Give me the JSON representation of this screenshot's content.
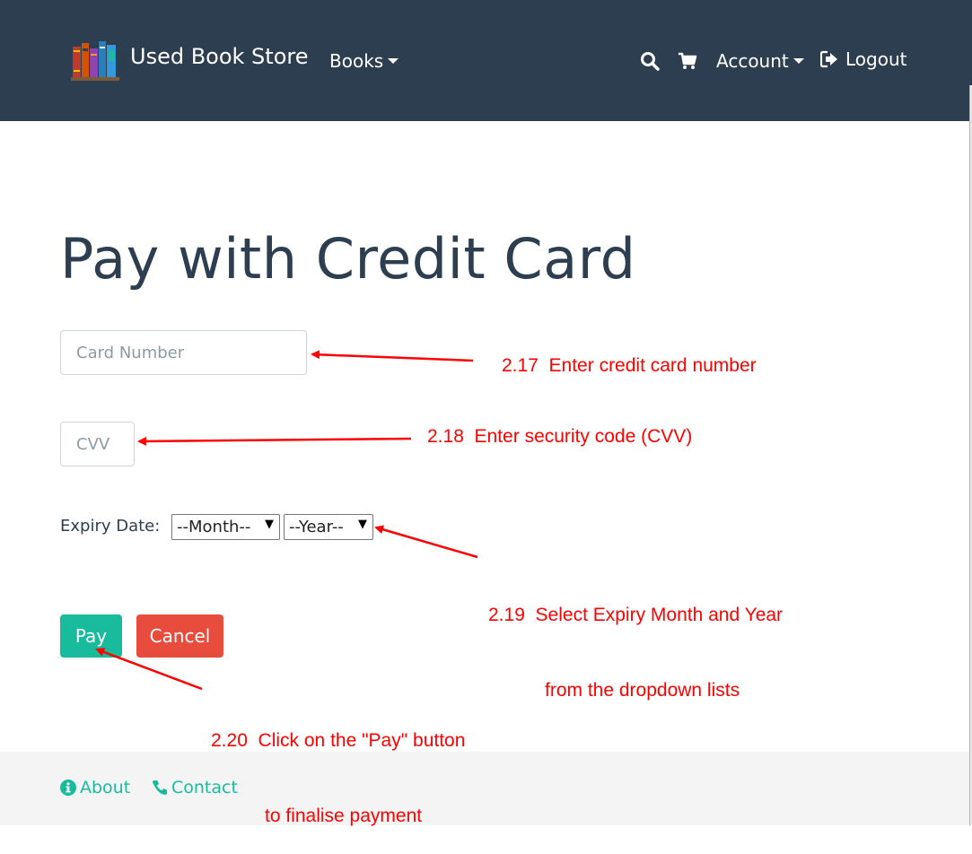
{
  "navbar": {
    "brand": "Used Book Store",
    "books_label": "Books",
    "account_label": "Account",
    "logout_label": "Logout",
    "icons": [
      "book-logo-icon",
      "search-icon",
      "cart-icon",
      "logout-icon"
    ]
  },
  "main": {
    "title": "Pay with Credit Card",
    "card_number_placeholder": "Card Number",
    "cvv_placeholder": "CVV",
    "expiry_label": "Expiry Date:",
    "month_selected": "--Month--",
    "year_selected": "--Year--",
    "pay_label": "Pay",
    "cancel_label": "Cancel"
  },
  "annotations": {
    "step_2_17": "2.17  Enter credit card number",
    "step_2_18": "2.18  Enter security code (CVV)",
    "step_2_19_line1": "2.19  Select Expiry Month and Year",
    "step_2_19_line2": "from the dropdown lists",
    "step_2_20_line1": "2.20  Click on the \"Pay\" button",
    "step_2_20_line2": "to finalise payment"
  },
  "footer": {
    "about_label": "About",
    "contact_label": "Contact"
  },
  "colors": {
    "navbar": "#2c3e50",
    "primary": "#18bc9c",
    "danger": "#e74c3c",
    "annotation": "#ff0000",
    "footer_bg": "#f4f4f4"
  }
}
